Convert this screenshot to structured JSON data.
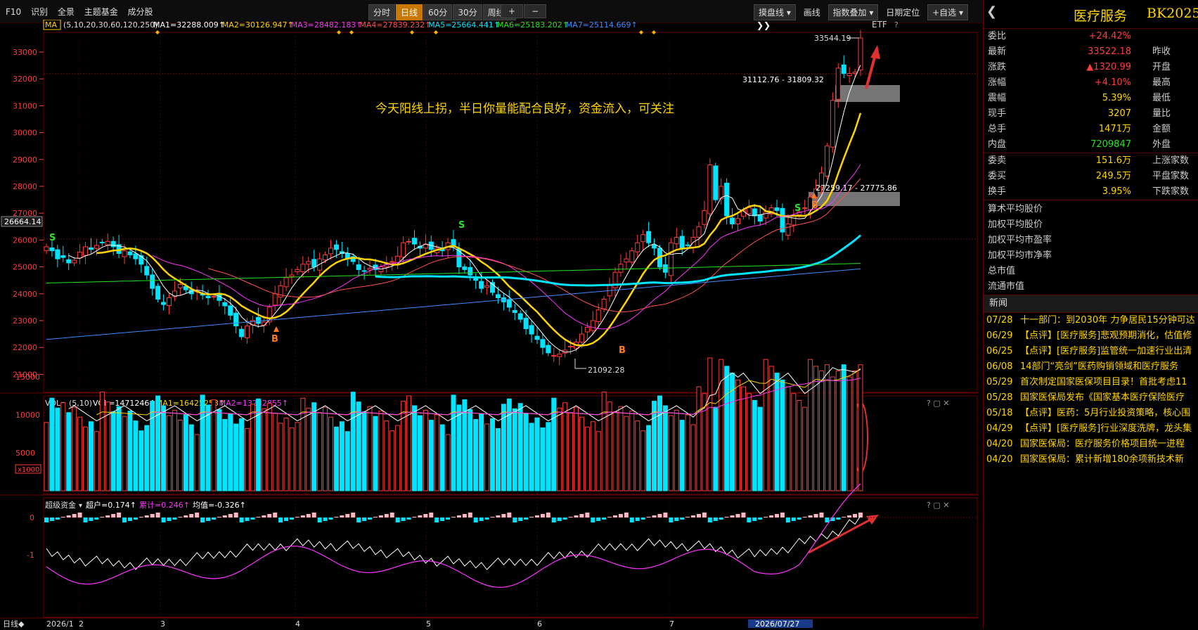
{
  "toolbar": {
    "left_items": [
      "F10",
      "识别",
      "全景",
      "主题基金",
      "成分股"
    ],
    "period_buttons": [
      "分时",
      "日线",
      "60分",
      "30分",
      "周线"
    ],
    "active_period": "日线",
    "plus_label": "+",
    "minus_label": "−",
    "right_buttons": [
      "摸盘线",
      "画线",
      "指数叠加",
      "日期定位",
      "+自选"
    ]
  },
  "ma_legend": {
    "name": "MA",
    "params": "(5,10,20,30,60,120,250)",
    "items": [
      {
        "label": "MA1=32288.009↑",
        "color": "#ffffff"
      },
      {
        "label": "MA2=30126.947↑",
        "color": "#ffd400"
      },
      {
        "label": "MA3=28482.183↑",
        "color": "#ff33ff"
      },
      {
        "label": "MA4=27839.232↑",
        "color": "#ff5050"
      },
      {
        "label": "MA5=25664.441↑",
        "color": "#00e5ff"
      },
      {
        "label": "MA6=25183.202↑",
        "color": "#22e622"
      },
      {
        "label": "MA7=25114.669↑",
        "color": "#3c8cff"
      }
    ],
    "etf_label": "ETF"
  },
  "price_axis": {
    "labels": [
      "33000",
      "32000",
      "31000",
      "30000",
      "29000",
      "28000",
      "27000",
      "26000",
      "25000",
      "24000",
      "23000",
      "22000",
      "21000"
    ],
    "current_tag": "26664.14"
  },
  "annotations": {
    "high_label": "33544.19",
    "low_label": "21092.28",
    "zone1_label": "31112.76 - 31809.32",
    "zone2_label": "27259.17 - 27775.86",
    "comment": "今天阳线上拐，半日你量能配合良好，资金流入，可关注",
    "s_marks": [
      "S",
      "S",
      "S"
    ],
    "b_marks": [
      "B",
      "B",
      "B"
    ]
  },
  "volume": {
    "legend_name": "VOL",
    "legend_params": "(5,10)",
    "items": [
      {
        "label": "VOL=14712464↓",
        "color": "#ffffff"
      },
      {
        "label": "MA1=16425253↑",
        "color": "#ffd400"
      },
      {
        "label": "MA2=13232855↑",
        "color": "#ff33ff"
      }
    ],
    "axis_labels": [
      "15000",
      "10000",
      "5000"
    ],
    "unit_tag": "x1000"
  },
  "fund": {
    "legend_name": "超级资金",
    "items": [
      {
        "label": "超户=0.174↑",
        "color": "#ffffff"
      },
      {
        "label": "累计=0.246↑",
        "color": "#ff33ff"
      },
      {
        "label": "均值=-0.326↑",
        "color": "#ffffff"
      }
    ],
    "axis_labels": [
      "0",
      "-1"
    ]
  },
  "date_axis": {
    "left_tag": "日线◆",
    "labels": [
      "2026/1",
      "2",
      "3",
      "4",
      "5",
      "6",
      "7"
    ],
    "cursor_date": "2026/07/27"
  },
  "panel": {
    "name": "医疗服务",
    "code": "BK2025",
    "rows": [
      {
        "k": "委比",
        "v": "+24.42%",
        "c": "red",
        "k2": ""
      },
      {
        "k": "最新",
        "v": "33522.18",
        "c": "red",
        "k2": "昨收"
      },
      {
        "k": "涨跌",
        "v": "▲1320.99",
        "c": "red",
        "k2": "开盘"
      },
      {
        "k": "涨幅",
        "v": "+4.10%",
        "c": "red",
        "k2": "最高"
      },
      {
        "k": "震幅",
        "v": "5.39%",
        "c": "yel",
        "k2": "最低"
      },
      {
        "k": "现手",
        "v": "3207",
        "c": "yel",
        "k2": "量比"
      },
      {
        "k": "总手",
        "v": "1471万",
        "c": "yel",
        "k2": "金额"
      },
      {
        "k": "内盘",
        "v": "7209847",
        "c": "grn",
        "k2": "外盘"
      }
    ],
    "rows2": [
      {
        "k": "委卖",
        "v": "151.6万",
        "c": "yel",
        "k2": "上涨家数"
      },
      {
        "k": "委买",
        "v": "249.5万",
        "c": "yel",
        "k2": "平盘家数"
      },
      {
        "k": "换手",
        "v": "3.95%",
        "c": "yel",
        "k2": "下跌家数"
      }
    ],
    "stats": [
      "算术平均股价",
      "加权平均股价",
      "加权平均市盈率",
      "加权平均市净率",
      "总市值",
      "流通市值"
    ],
    "news_title": "新闻",
    "news": [
      {
        "d": "07/28",
        "t": "十一部门：到2030年 力争居民15分钟可达"
      },
      {
        "d": "06/29",
        "t": "【点评】[医疗服务]悲观预期消化，估值修"
      },
      {
        "d": "06/25",
        "t": "【点评】[医疗服务]监管统一加速行业出清"
      },
      {
        "d": "06/08",
        "t": "14部门“亮剑”医药购销领域和医疗服务"
      },
      {
        "d": "05/29",
        "t": "首次制定国家医保项目目录！首批考虑11"
      },
      {
        "d": "05/28",
        "t": "国家医保局发布《国家基本医疗保险医疗"
      },
      {
        "d": "05/18",
        "t": "【点评】医药：5月行业投资策略，核心围"
      },
      {
        "d": "04/29",
        "t": "【点评】[医疗服务]行业深度洗牌，龙头集"
      },
      {
        "d": "04/20",
        "t": "国家医保局：医疗服务价格项目统一进程"
      },
      {
        "d": "04/20",
        "t": "国家医保局：累计新增180余项新技术新"
      }
    ]
  }
}
